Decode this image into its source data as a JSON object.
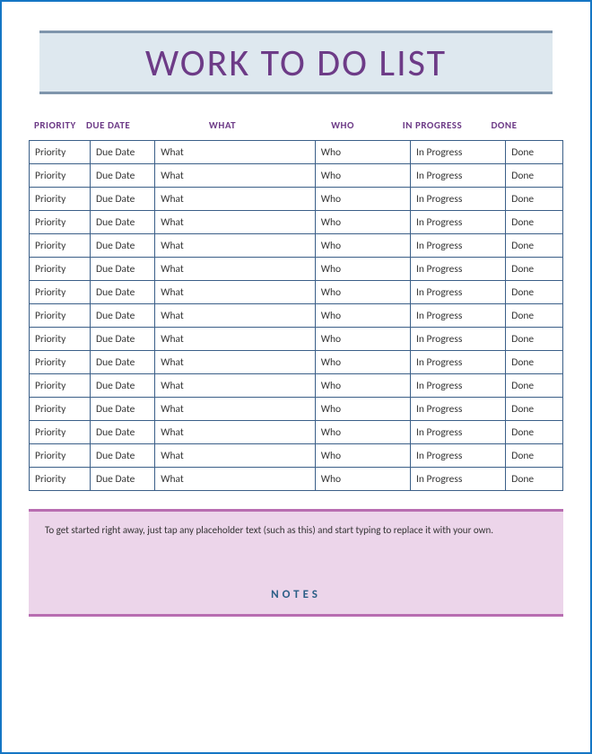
{
  "title": "WORK TO DO LIST",
  "columns": [
    "PRIORITY",
    "DUE DATE",
    "WHAT",
    "WHO",
    "IN PROGRESS",
    "DONE"
  ],
  "rows": [
    [
      "Priority",
      "Due Date",
      "What",
      "Who",
      "In Progress",
      "Done"
    ],
    [
      "Priority",
      "Due Date",
      "What",
      "Who",
      "In Progress",
      "Done"
    ],
    [
      "Priority",
      "Due Date",
      "What",
      "Who",
      "In Progress",
      "Done"
    ],
    [
      "Priority",
      "Due Date",
      "What",
      "Who",
      "In Progress",
      "Done"
    ],
    [
      "Priority",
      "Due Date",
      "What",
      "Who",
      "In Progress",
      "Done"
    ],
    [
      "Priority",
      "Due Date",
      "What",
      "Who",
      "In Progress",
      "Done"
    ],
    [
      "Priority",
      "Due Date",
      "What",
      "Who",
      "In Progress",
      "Done"
    ],
    [
      "Priority",
      "Due Date",
      "What",
      "Who",
      "In Progress",
      "Done"
    ],
    [
      "Priority",
      "Due Date",
      "What",
      "Who",
      "In Progress",
      "Done"
    ],
    [
      "Priority",
      "Due Date",
      "What",
      "Who",
      "In Progress",
      "Done"
    ],
    [
      "Priority",
      "Due Date",
      "What",
      "Who",
      "In Progress",
      "Done"
    ],
    [
      "Priority",
      "Due Date",
      "What",
      "Who",
      "In Progress",
      "Done"
    ],
    [
      "Priority",
      "Due Date",
      "What",
      "Who",
      "In Progress",
      "Done"
    ],
    [
      "Priority",
      "Due Date",
      "What",
      "Who",
      "In Progress",
      "Done"
    ],
    [
      "Priority",
      "Due Date",
      "What",
      "Who",
      "In Progress",
      "Done"
    ]
  ],
  "notes": {
    "instruction": "To get started right away, just tap any placeholder text (such as this) and start typing to replace it with your own.",
    "heading": "NOTES"
  }
}
